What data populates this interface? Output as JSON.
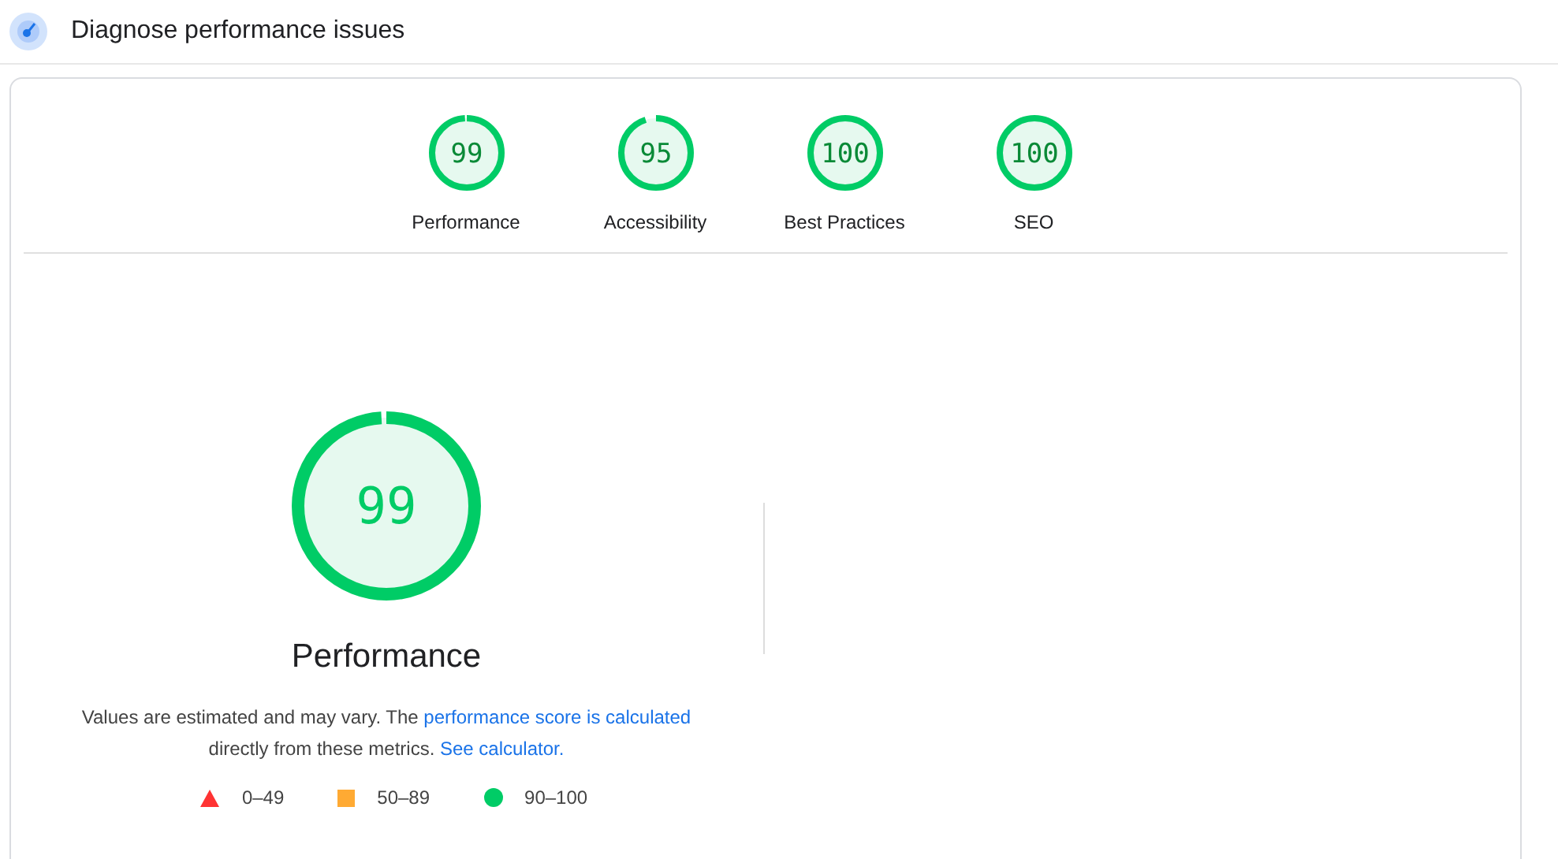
{
  "header": {
    "title": "Diagnose performance issues"
  },
  "categories": [
    {
      "score": "99",
      "label": "Performance",
      "level": 0.99
    },
    {
      "score": "95",
      "label": "Accessibility",
      "level": 0.95
    },
    {
      "score": "100",
      "label": "Best Practices",
      "level": 1
    },
    {
      "score": "100",
      "label": "SEO",
      "level": 1
    }
  ],
  "main_gauge": {
    "score": "99",
    "label": "Performance",
    "level": 0.99
  },
  "description": [
    {
      "kind": "text",
      "text": "Values are estimated and may vary. The "
    },
    {
      "kind": "link",
      "text": "performance score is calculated"
    },
    {
      "kind": "text",
      "text": " directly from these metrics. "
    },
    {
      "kind": "link",
      "text": "See calculator."
    }
  ],
  "legend": [
    {
      "kind": "triangle",
      "color": "#ff3333",
      "label": "0–49"
    },
    {
      "kind": "square",
      "color": "#ffaa33",
      "label": "50–89"
    },
    {
      "kind": "circle",
      "color": "#00cc66",
      "label": "90–100"
    }
  ]
}
